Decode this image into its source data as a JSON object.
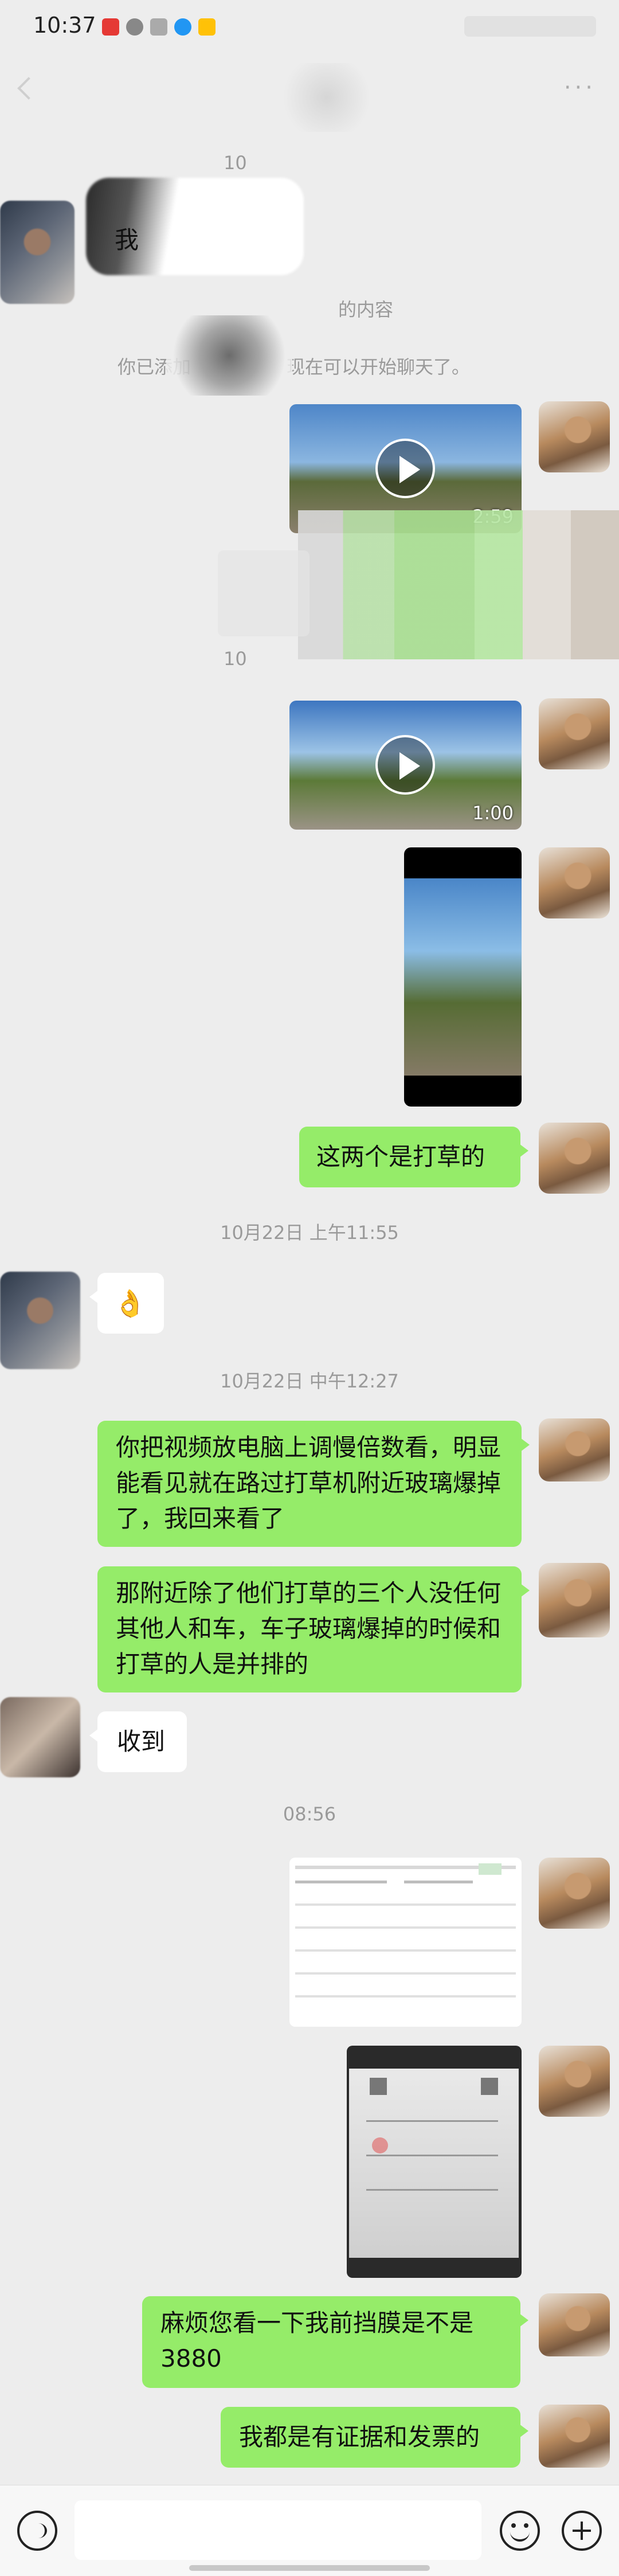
{
  "status_bar": {
    "time": "10:37"
  },
  "header": {
    "more": "···"
  },
  "system": {
    "timestamp_top": "10",
    "greeting_fragment": "我",
    "notice_1": "的内容",
    "notice_2": "你已添加",
    "notice_3": "现在可以开始聊天了。",
    "timestamp_mid": "10"
  },
  "videos": [
    {
      "duration": "2:59"
    },
    {
      "duration": "1:00"
    }
  ],
  "messages": {
    "m1": "这两个是打草的",
    "ts1": "10月22日 上午11:55",
    "m2": "👌",
    "ts2": "10月22日 中午12:27",
    "m3": "你把视频放电脑上调慢倍数看，明显能看见就在路过打草机附近玻璃爆掉了，我回来看了",
    "m4": "那附近除了他们打草的三个人没任何其他人和车，车子玻璃爆掉的时候和打草的人是并排的",
    "m5": "收到",
    "ts3": "08:56",
    "m6": "麻烦您看一下我前挡膜是不是3880",
    "m7": "我都是有证据和发票的"
  },
  "colors": {
    "bubble_green": "#95ec69",
    "bubble_white": "#ffffff",
    "background": "#ededed"
  },
  "icons": [
    "back-chevron-icon",
    "more-icon",
    "play-icon",
    "voice-icon",
    "emoji-icon",
    "plus-icon"
  ]
}
